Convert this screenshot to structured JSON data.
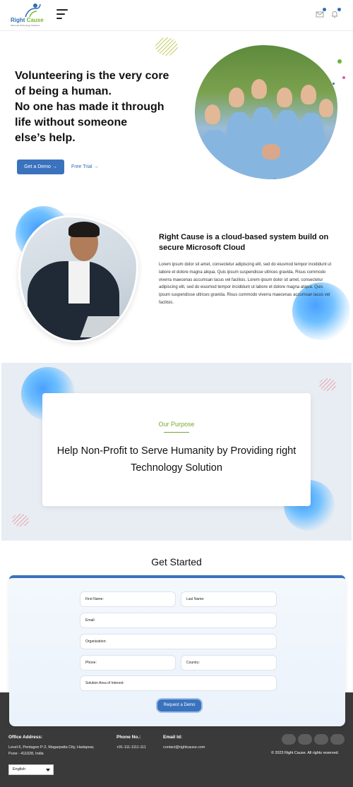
{
  "brand": {
    "name_part1": "Right",
    "name_part2": "Cause",
    "tagline": "Microsoft Technology Solutions",
    "blue": "#2f6db8",
    "green": "#77b82a"
  },
  "header": {
    "menu_icon": "hamburger-icon",
    "mail_icon": "mail-icon",
    "bell_icon": "bell-icon"
  },
  "hero": {
    "lines": [
      "Volunteering is the very core",
      "of being a human.",
      "No one has made it through",
      "life without someone",
      "else’s help."
    ],
    "demo_button": "Get a Demo  →",
    "trial_link": "Free Trial  →"
  },
  "about": {
    "title": "Right Cause is a cloud-based system build on secure Microsoft Cloud",
    "body": "Lorem ipsum dolor sit amet, consectetur adipiscing elit, sed do eiusmod tempor incididunt ut labore et dolore magna aliqua. Quis ipsum suspendisse ultrices gravida. Risus commodo viverra maecenas accumsan lacus vel facilisis.  Lorem ipsum dolor sit amet, consectetur adipiscing elit, sed do eiusmod tempor incididunt ut labore et dolore magna aliqua. Quis ipsum suspendisse ultrices gravida. Risus commodo viverra maecenas accumsan lacus vel facilisis."
  },
  "purpose": {
    "kicker": "Our Purpose",
    "heading": "Help Non-Profit to Serve Humanity by Providing right Technology Solution"
  },
  "get_started": {
    "title": "Get Started",
    "fields": {
      "first_name": "First Name:",
      "last_name": "Last Name:",
      "email": "Email:",
      "organization": "Organization:",
      "phone": "Phone:",
      "country": "Country:",
      "solution": "Solution Area of Interest:"
    },
    "submit": "Request a Demo"
  },
  "footer": {
    "office_label": "Office Address:",
    "office_lines": [
      "Level 6, Pentagon P-2, Magarpatta City, Hadapsar,",
      "Pune - 411028, India"
    ],
    "phone_label": "Phone No.:",
    "phone": "+91-111-1111-111",
    "email_label": "Email Id:",
    "email": "contact@rightcause.com",
    "copyright": "© 2023 Right Cause. All rights reserved.",
    "language": "English"
  }
}
